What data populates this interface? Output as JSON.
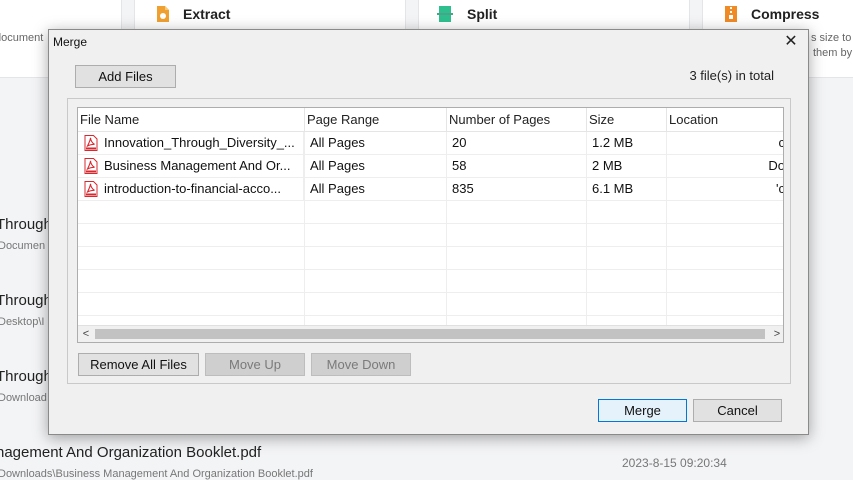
{
  "background": {
    "tools": [
      {
        "title": "Extract",
        "desc": "document",
        "icon": "extract-icon",
        "color": "#f0a030"
      },
      {
        "title": "Split",
        "desc": "",
        "icon": "split-icon",
        "color": "#2fbf8f"
      },
      {
        "title": "Compress",
        "desc": "s size to",
        "desc2": "them by",
        "icon": "compress-icon",
        "color": "#f08a24"
      }
    ],
    "recent": [
      {
        "name": "Through",
        "path": "Documen"
      },
      {
        "name": "Through",
        "path": "Desktop\\I"
      },
      {
        "name": "Through",
        "path": "Download"
      },
      {
        "name": "nagement And Organization Booklet.pdf",
        "path": "Downloads\\Business Management And Organization Booklet.pdf",
        "date": "2023-8-15   09:20:34"
      }
    ]
  },
  "dialog": {
    "title": "Merge",
    "close_glyph": "✕",
    "add_files_label": "Add Files",
    "file_count": "3 file(s) in total",
    "columns": [
      "File Name",
      "Page Range",
      "Number of Pages",
      "Size",
      "Location"
    ],
    "files": [
      {
        "name": "Innovation_Through_Diversity_...",
        "range": "All Pages",
        "pages": "20",
        "size": "1.2 MB",
        "location": "c"
      },
      {
        "name": "Business Management And Or...",
        "range": "All Pages",
        "pages": "58",
        "size": "2 MB",
        "location": "Do"
      },
      {
        "name": "introduction-to-financial-acco...",
        "range": "All Pages",
        "pages": "835",
        "size": "6.1 MB",
        "location": "'c"
      }
    ],
    "remove_all_label": "Remove All Files",
    "move_up_label": "Move Up",
    "move_down_label": "Move Down",
    "merge_label": "Merge",
    "cancel_label": "Cancel",
    "scroll_left": "<",
    "scroll_right": ">"
  },
  "colors": {
    "pdf_red": "#d7282f",
    "accent": "#0078d7"
  }
}
